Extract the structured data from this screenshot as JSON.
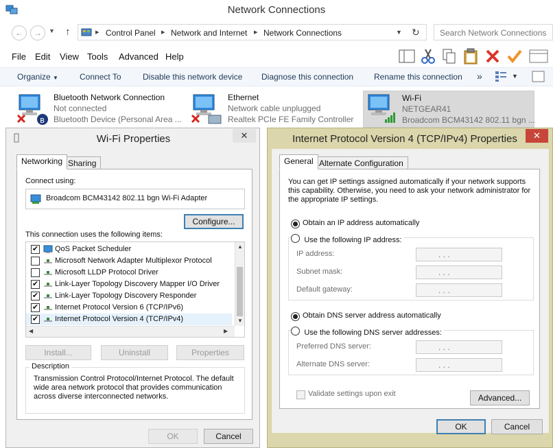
{
  "window": {
    "title": "Network Connections"
  },
  "address_bar": {
    "crumbs": [
      "Control Panel",
      "Network and Internet",
      "Network Connections"
    ],
    "search_placeholder": "Search Network Connections"
  },
  "menu": [
    "File",
    "Edit",
    "View",
    "Tools",
    "Advanced",
    "Help"
  ],
  "commands": [
    "Organize",
    "Connect To",
    "Disable this network device",
    "Diagnose this connection",
    "Rename this connection"
  ],
  "connections": [
    {
      "name": "Bluetooth Network Connection",
      "status": "Not connected",
      "device": "Bluetooth Device (Personal Area ..."
    },
    {
      "name": "Ethernet",
      "status": "Network cable unplugged",
      "device": "Realtek PCIe FE Family Controller"
    },
    {
      "name": "Wi-Fi",
      "status": "NETGEAR41",
      "device": "Broadcom BCM43142 802.11 bgn ..."
    }
  ],
  "wifi_props": {
    "title": "Wi-Fi Properties",
    "tabs": [
      "Networking",
      "Sharing"
    ],
    "connect_using_label": "Connect using:",
    "adapter": "Broadcom BCM43142 802.11 bgn Wi-Fi Adapter",
    "configure_label": "Configure...",
    "items_label": "This connection uses the following items:",
    "items": [
      {
        "label": "QoS Packet Scheduler",
        "checked": true
      },
      {
        "label": "Microsoft Network Adapter Multiplexor Protocol",
        "checked": false
      },
      {
        "label": "Microsoft LLDP Protocol Driver",
        "checked": false
      },
      {
        "label": "Link-Layer Topology Discovery Mapper I/O Driver",
        "checked": true
      },
      {
        "label": "Link-Layer Topology Discovery Responder",
        "checked": true
      },
      {
        "label": "Internet Protocol Version 6 (TCP/IPv6)",
        "checked": true
      },
      {
        "label": "Internet Protocol Version 4 (TCP/IPv4)",
        "checked": true
      }
    ],
    "buttons": {
      "install": "Install...",
      "uninstall": "Uninstall",
      "properties": "Properties",
      "ok": "OK",
      "cancel": "Cancel"
    },
    "description_label": "Description",
    "description_text": "Transmission Control Protocol/Internet Protocol. The default wide area network protocol that provides communication across diverse interconnected networks."
  },
  "ipv4_props": {
    "title": "Internet Protocol Version 4 (TCP/IPv4) Properties",
    "tabs": [
      "General",
      "Alternate Configuration"
    ],
    "intro": "You can get IP settings assigned automatically if your network supports this capability. Otherwise, you need to ask your network administrator for the appropriate IP settings.",
    "obtain_ip_auto": "Obtain an IP address automatically",
    "use_following_ip": "Use the following IP address:",
    "ip_address_label": "IP address:",
    "subnet_mask_label": "Subnet mask:",
    "default_gateway_label": "Default gateway:",
    "obtain_dns_auto": "Obtain DNS server address automatically",
    "use_following_dns": "Use the following DNS server addresses:",
    "preferred_dns_label": "Preferred DNS server:",
    "alternate_dns_label": "Alternate DNS server:",
    "validate_label": "Validate settings upon exit",
    "advanced_label": "Advanced...",
    "ok_label": "OK",
    "cancel_label": "Cancel",
    "ip_placeholder": ".     .     ."
  },
  "colors": {
    "accent": "#3c7fb1",
    "ipv4_frame": "#dbd6ab",
    "close_red": "#c7463a"
  }
}
